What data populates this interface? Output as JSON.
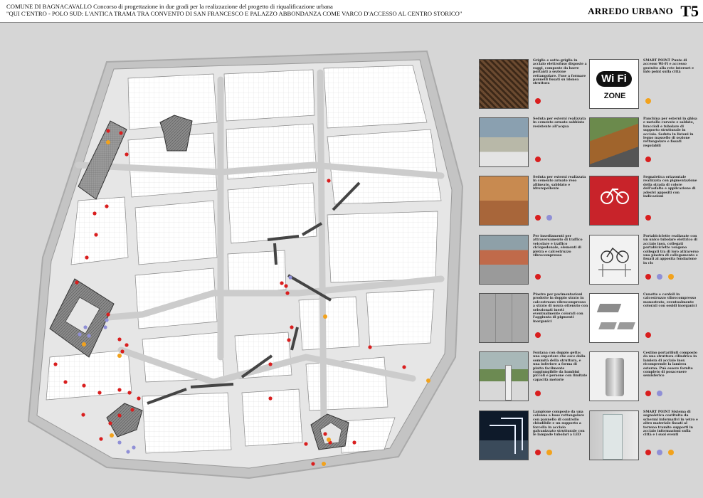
{
  "header": {
    "line1": "COMUNE DI BAGNACAVALLO Concorso di progettazione in due gradi per la realizzazione del progetto di riqualificazione urbana",
    "line2": "\"QUI C'ENTRO - POLO SUD: L'ANTICA TRAMA TRA CONVENTO DI SAN FRANCESCO E PALAZZO ABBONDANZA COME VARCO D'ACCESSO AL CENTRO STORICO\"",
    "section": "ARREDO URBANO",
    "code": "T5"
  },
  "colors": {
    "red": "#d91e1e",
    "blue": "#8f8fd6",
    "orange": "#f2a21c"
  },
  "items": [
    {
      "desc": "Griglie e sotto-griglia in acciaio elettrofuso disposte a raggi, composte da barre portanti a sezione rettangolare. Fuse a formare pannelli fissati su idonea struttura",
      "dots": [
        "red"
      ]
    },
    {
      "desc": "SMART POINT Punto di accesso Wi-Fi e accesso gratuito alla rete internet e info point sulla città",
      "dots": [
        "orange"
      ],
      "label_wifi": "Wi Fi",
      "label_zone": "ZONE"
    },
    {
      "desc": "Seduta per esterni realizzata in cemento armato sabbiato resistente all'acqua",
      "dots": [
        "red"
      ]
    },
    {
      "desc": "Panchina per esterni in ghisa e metallo curvato e saldato, braccioli e tubolare di supporto strutturale in acciaio. Seduta in listoni in legno massello di sezione rettangolare e fissati regolabili",
      "dots": [
        "red"
      ]
    },
    {
      "desc": "Seduta per esterni realizzata in cemento armato reso allineato, sabbiato e idrorepellente",
      "dots": [
        "red",
        "blue"
      ]
    },
    {
      "desc": "Segnaletica orizzontale realizzata con pigmentazione della strada di colore dell'asfalto e applicazione di adesivi appositi con indicazioni",
      "dots": [
        "red"
      ]
    },
    {
      "desc": "Per insediamenti per attraversamento di traffico veicolare e traffico ciclopedonale, elementi di pietra e calcestruzzo vibrocompresso",
      "dots": [
        "red"
      ]
    },
    {
      "desc": "Portabiciclette realizzate con un unico tubolare elettrico di acciaio inox, collegati portabiciclette vengono collegati tra di loro attraverso una piastra di collegamento e fissati al apposita fondazione in cls",
      "dots": [
        "red",
        "blue",
        "orange"
      ]
    },
    {
      "desc": "Piastre per pavimentazioni prodotte in doppio strato in calcestruzzo vibrocompresso a strato di usura ottenuto con selezionati inerti eventualmente colorati con l'aggiunta di pigmenti inorganici",
      "dots": [
        "red"
      ]
    },
    {
      "desc": "Cunette e cordoli in calcestruzzo vibrocompresso monostrato, eventualmente colorati con ossidi inorganici",
      "dots": [
        "red"
      ]
    },
    {
      "desc": "Fontana con doppio getto: una superiore che esce dalla sommità della struttura, e una inferiore a forma di piatto facilmente raggiungibile da bambini piccoli e persone con limitate capacità motorie",
      "dots": [
        "red"
      ]
    },
    {
      "desc": "Cestino portarifiuti composto da una struttura cilindrica in lamiera di acciaio inox ricomprende la lamiera esterna. Può essere fornito completo di posacenere semisferico",
      "dots": [
        "red",
        "blue"
      ]
    },
    {
      "desc": "Lampione composto da una colonna a base rettangolare con pannello di controllo chiudibile e un supporto a forcella in acciaio galvanizzato strutturale con le lampade tubolari a LED",
      "dots": [
        "red",
        "orange"
      ]
    },
    {
      "desc": "SMART POINT Sistema di segnaletica costituito da schermi informativi in vetro e altro materiale fissati al terreno tramite supporti in acciaio informazioni sulla città e i suoi eventi",
      "dots": [
        "red",
        "blue",
        "orange"
      ]
    }
  ]
}
